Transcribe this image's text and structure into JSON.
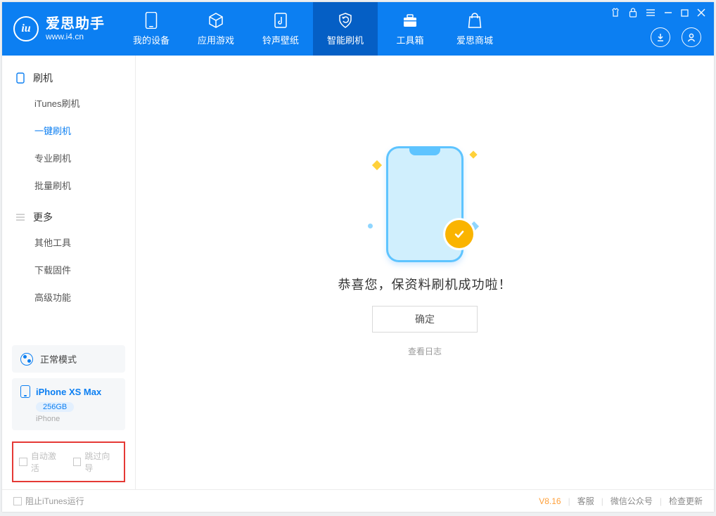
{
  "app": {
    "name": "爱思助手",
    "site": "www.i4.cn"
  },
  "nav": {
    "tabs": [
      {
        "label": "我的设备"
      },
      {
        "label": "应用游戏"
      },
      {
        "label": "铃声壁纸"
      },
      {
        "label": "智能刷机"
      },
      {
        "label": "工具箱"
      },
      {
        "label": "爱思商城"
      }
    ]
  },
  "sidebar": {
    "section_flash": "刷机",
    "flash_items": [
      {
        "label": "iTunes刷机"
      },
      {
        "label": "一键刷机"
      },
      {
        "label": "专业刷机"
      },
      {
        "label": "批量刷机"
      }
    ],
    "section_more": "更多",
    "more_items": [
      {
        "label": "其他工具"
      },
      {
        "label": "下载固件"
      },
      {
        "label": "高级功能"
      }
    ],
    "mode_label": "正常模式",
    "device": {
      "name": "iPhone XS Max",
      "storage": "256GB",
      "type": "iPhone"
    },
    "chk_auto_activate": "自动激活",
    "chk_skip_guide": "跳过向导"
  },
  "main": {
    "success_title": "恭喜您，保资料刷机成功啦！",
    "confirm_label": "确定",
    "view_log_label": "查看日志"
  },
  "footer": {
    "block_itunes": "阻止iTunes运行",
    "version": "V8.16",
    "support": "客服",
    "wechat": "微信公众号",
    "check_update": "检查更新"
  }
}
